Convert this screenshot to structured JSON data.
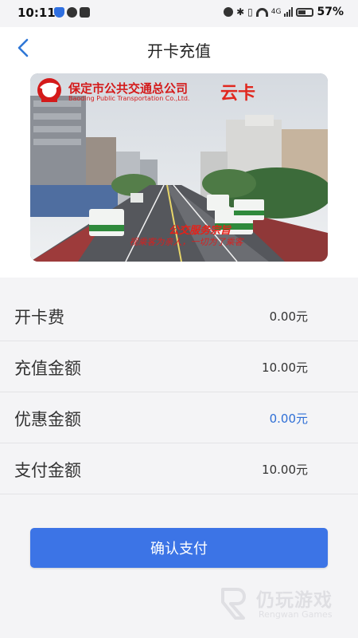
{
  "status_bar": {
    "time": "10:11",
    "network": "4G",
    "battery": "57%"
  },
  "nav": {
    "title": "开卡充值"
  },
  "card": {
    "company_cn": "保定市公共交通总公司",
    "company_en": "Baoding Public Transportation Co.,Ltd.",
    "product": "云卡",
    "slogan": "公交服务宗旨",
    "slogan_sub": "视乘客为亲人，一切为了乘客"
  },
  "rows": [
    {
      "label": "开卡费",
      "value": "0.00元",
      "highlight": false
    },
    {
      "label": "充值金额",
      "value": "10.00元",
      "highlight": false
    },
    {
      "label": "优惠金额",
      "value": "0.00元",
      "highlight": true
    },
    {
      "label": "支付金额",
      "value": "10.00元",
      "highlight": false
    }
  ],
  "actions": {
    "confirm_pay": "确认支付"
  },
  "watermark": {
    "cn": "仍玩游戏",
    "en": "Rengwan Games"
  },
  "colors": {
    "accent": "#3c74e6",
    "highlight_value": "#2f6fd6",
    "brand_red": "#d41a1a"
  }
}
